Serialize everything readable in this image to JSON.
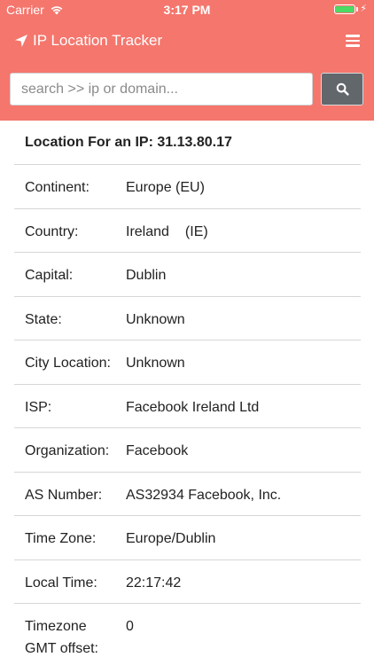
{
  "status_bar": {
    "carrier": "Carrier",
    "time": "3:17 PM",
    "wifi_icon": "wifi-icon",
    "battery_icon": "battery-icon",
    "battery_level_percent": 100,
    "charging_icon": "bolt-icon"
  },
  "nav": {
    "icon": "location-arrow-icon",
    "title": "IP Location Tracker",
    "menu_icon": "hamburger-menu-icon"
  },
  "search": {
    "placeholder": "search >> ip or domain...",
    "value": "",
    "button_icon": "search-icon"
  },
  "result": {
    "title": "Location For an IP: 31.13.80.17",
    "rows": [
      {
        "label": "Continent:",
        "value": "Europe (EU)"
      },
      {
        "label": "Country:",
        "value": "Ireland",
        "value_code": "(IE)"
      },
      {
        "label": "Capital:",
        "value": "Dublin"
      },
      {
        "label": "State:",
        "value": "Unknown"
      },
      {
        "label": "City Location:",
        "value": "Unknown"
      },
      {
        "label": "ISP:",
        "value": "Facebook Ireland Ltd"
      },
      {
        "label": "Organization:",
        "value": "Facebook"
      },
      {
        "label": "AS Number:",
        "value": "AS32934 Facebook, Inc."
      },
      {
        "label": "Time Zone:",
        "value": "Europe/Dublin"
      },
      {
        "label": "Local Time:",
        "value": "22:17:42"
      },
      {
        "label_line1": "Timezone",
        "label_line2": "GMT offset:",
        "value": "0"
      }
    ]
  },
  "colors": {
    "accent": "#f4766d",
    "search_button": "#62676c",
    "battery_fill": "#4cd964",
    "divider": "#d6d6d6",
    "text": "#222222"
  }
}
